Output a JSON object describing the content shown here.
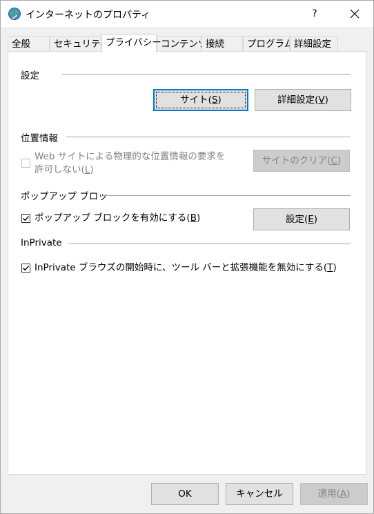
{
  "window": {
    "title": "インターネットのプロパティ",
    "help_label": "?",
    "close_label": "✕"
  },
  "tabs": [
    {
      "label": "全般"
    },
    {
      "label": "セキュリティ"
    },
    {
      "label": "プライバシー"
    },
    {
      "label": "コンテンツ"
    },
    {
      "label": "接続"
    },
    {
      "label": "プログラム"
    },
    {
      "label": "詳細設定"
    }
  ],
  "active_tab": "プライバシー",
  "settings": {
    "group_label": "設定",
    "sites_button": {
      "text": "サイト(",
      "key": "S",
      "end": ")"
    },
    "advanced_button": {
      "text": "詳細設定(",
      "key": "V",
      "end": ")"
    }
  },
  "location": {
    "group_label": "位置情報",
    "checkbox_line1": "Web サイトによる物理的な位置情報の要求を",
    "checkbox_line2": {
      "text": "許可しない(",
      "key": "L",
      "end": ")"
    },
    "checked": false,
    "clear_button": {
      "text": "サイトのクリア(",
      "key": "C",
      "end": ")"
    }
  },
  "popup": {
    "group_label": "ポップアップ ブロッ",
    "checkbox": {
      "text": "ポップアップ ブロックを有効にする(",
      "key": "B",
      "end": ")"
    },
    "checked": true,
    "settings_button": {
      "text": "設定(",
      "key": "E",
      "end": ")"
    }
  },
  "inprivate": {
    "group_label": "InPrivate",
    "checkbox": {
      "text": "InPrivate ブラウズの開始時に、ツール バーと拡張機能を無効にする(",
      "key": "T",
      "end": ")"
    },
    "checked": true
  },
  "footer": {
    "ok_label": "OK",
    "cancel_label": "キャンセル",
    "apply": {
      "text": "適用(",
      "key": "A",
      "end": ")"
    }
  },
  "colors": {
    "accent": "#0078d7",
    "panel_bg": "#ffffff",
    "window_bg": "#f0f0f0"
  }
}
